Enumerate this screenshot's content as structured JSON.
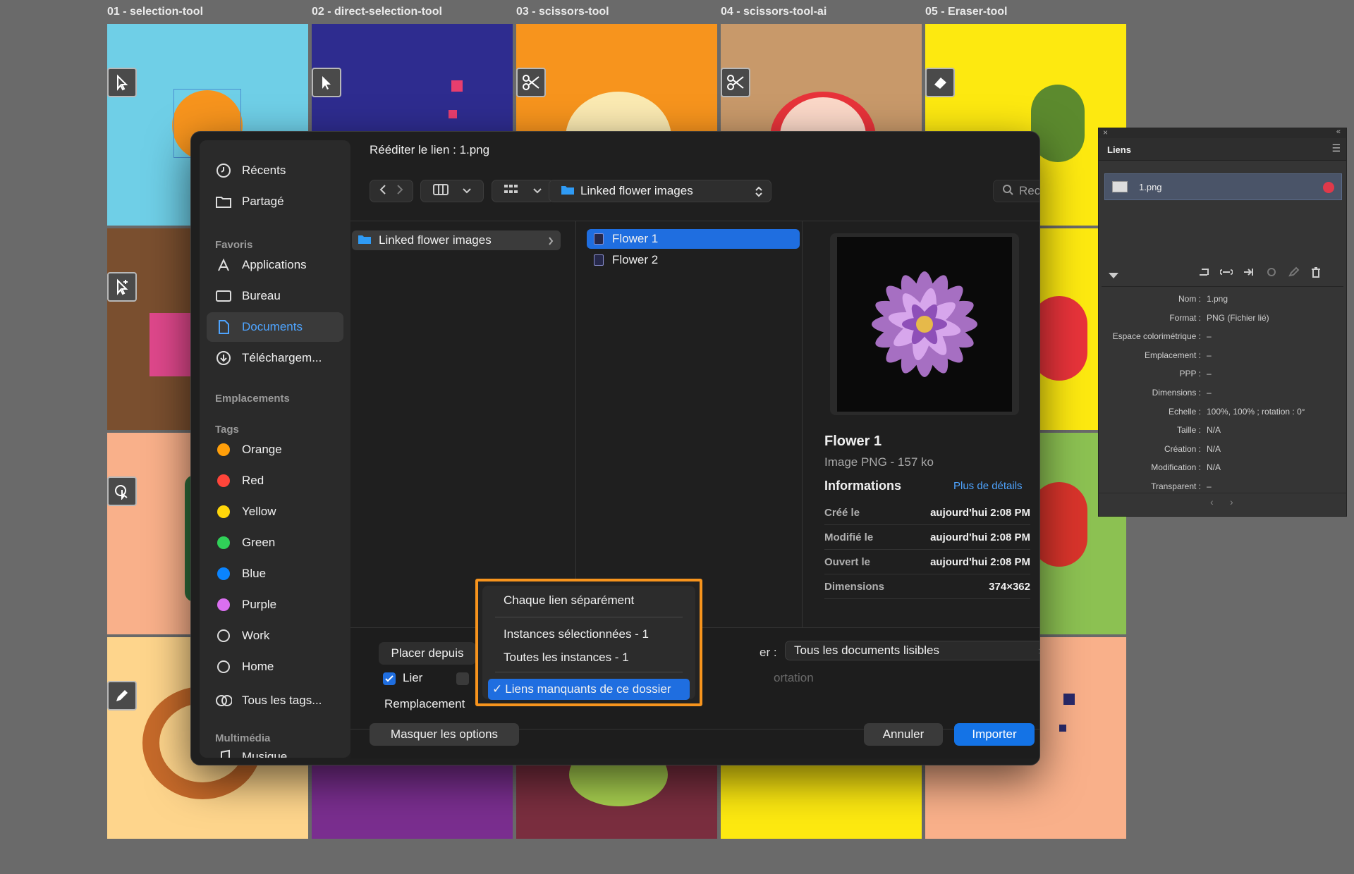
{
  "artboards": [
    {
      "label": "01 - selection-tool",
      "color": "#6fcfe7"
    },
    {
      "label": "02 - direct-selection-tool",
      "color": "#2e2c8f"
    },
    {
      "label": "03 - scissors-tool",
      "color": "#f7941d"
    },
    {
      "label": "04 - scissors-tool-ai",
      "color": "#c8996a"
    },
    {
      "label": "05 - Eraser-tool",
      "color": "#fde910"
    }
  ],
  "dialog": {
    "title": "Rééditer le lien : 1.png",
    "location_popup": "Linked flower images",
    "search_placeholder": "Rechercher",
    "sidebar": {
      "top_items": [
        "Récents",
        "Partagé"
      ],
      "favoris_heading": "Favoris",
      "favoris": [
        "Applications",
        "Bureau",
        "Documents",
        "Téléchargem..."
      ],
      "emplacements_heading": "Emplacements",
      "tags_heading": "Tags",
      "tags": [
        {
          "label": "Orange",
          "color": "#ff9f0a"
        },
        {
          "label": "Red",
          "color": "#ff453a"
        },
        {
          "label": "Yellow",
          "color": "#ffd60a"
        },
        {
          "label": "Green",
          "color": "#30d158"
        },
        {
          "label": "Blue",
          "color": "#0a84ff"
        },
        {
          "label": "Purple",
          "color": "#da6ff0"
        },
        {
          "label": "Work",
          "color": ""
        },
        {
          "label": "Home",
          "color": ""
        }
      ],
      "all_tags": "Tous les tags...",
      "multimedia_heading": "Multimédia",
      "musique": "Musique"
    },
    "column1": {
      "folder": "Linked flower images"
    },
    "column2": {
      "files": [
        "Flower 1",
        "Flower 2"
      ]
    },
    "preview": {
      "name": "Flower 1",
      "kind": "Image PNG - 157 ko",
      "info_heading": "Informations",
      "more_details": "Plus de détails",
      "rows": [
        {
          "key": "Créé le",
          "value": "aujourd'hui 2:08 PM"
        },
        {
          "key": "Modifié le",
          "value": "aujourd'hui 2:08 PM"
        },
        {
          "key": "Ouvert le",
          "value": "aujourd'hui 2:08 PM"
        },
        {
          "key": "Dimensions",
          "value": "374×362"
        }
      ]
    },
    "options": {
      "placer_depuis": "Placer depuis",
      "format_label_fragment": "er :",
      "format_value": "Tous les documents lisibles",
      "lier": "Lier",
      "import_fragment": "ortation",
      "remplacement": "Remplacement"
    },
    "menu": {
      "items": [
        "Chaque lien séparément",
        "Instances sélectionnées - 1",
        "Toutes les instances - 1",
        "Liens manquants de ce dossier"
      ],
      "selected": "Liens manquants de ce dossier",
      "checkmark": "✓"
    },
    "buttons": {
      "hide_options": "Masquer les options",
      "cancel": "Annuler",
      "import": "Importer"
    }
  },
  "links_panel": {
    "title": "Liens",
    "item": "1.png",
    "props": [
      {
        "key": "Nom :",
        "value": "1.png"
      },
      {
        "key": "Format :",
        "value": "PNG (Fichier lié)"
      },
      {
        "key": "Espace colorimétrique :",
        "value": "–"
      },
      {
        "key": "Emplacement :",
        "value": "–"
      },
      {
        "key": "PPP :",
        "value": "–"
      },
      {
        "key": "Dimensions :",
        "value": "–"
      },
      {
        "key": "Echelle :",
        "value": "100%, 100% ; rotation : 0°"
      },
      {
        "key": "Taille :",
        "value": "N/A"
      },
      {
        "key": "Création :",
        "value": "N/A"
      },
      {
        "key": "Modification :",
        "value": "N/A"
      },
      {
        "key": "Transparent :",
        "value": "–"
      }
    ]
  }
}
